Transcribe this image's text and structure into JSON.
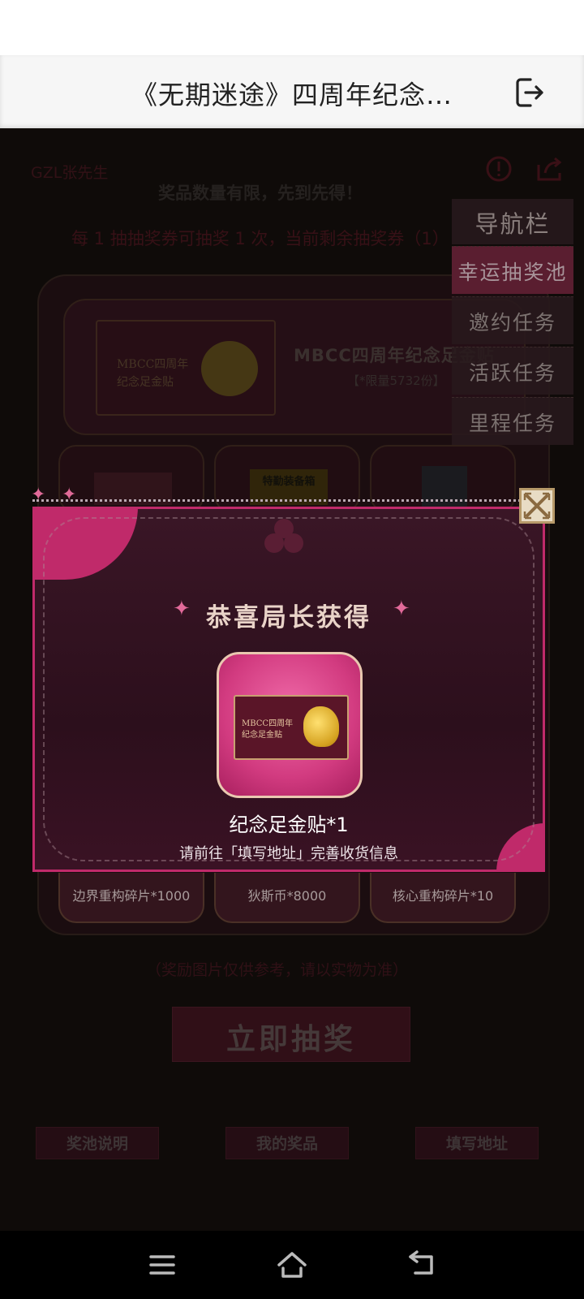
{
  "browser": {
    "title": "《无期迷途》四周年纪念…",
    "exit_icon": "exit-icon"
  },
  "page": {
    "user_name": "GZL张先生",
    "notice": "奖品数量有限，先到先得！",
    "ticket_info": "每 1 抽抽奖券可抽奖 1 次，当前剩余抽奖券（1）",
    "grand_prize": {
      "card_line1": "MBCC四周年",
      "card_line2": "纪念足金贴",
      "name": "MBCC四周年纪念足金贴",
      "limit": "【*限量5732份】"
    },
    "prizes_top_visible": [
      "",
      "特勤装备箱",
      ""
    ],
    "prizes_bottom": [
      "边界重构碎片*1000",
      "狄斯币*8000",
      "核心重构碎片*10"
    ],
    "reference_note": "（奖励图片仅供参考，请以实物为准）",
    "draw_button": "立即抽奖",
    "bottom_buttons": [
      "奖池说明",
      "我的奖品",
      "填写地址"
    ]
  },
  "side_nav": {
    "header": "导航栏",
    "items": [
      {
        "label": "幸运抽奖池",
        "active": true
      },
      {
        "label": "邀约任务",
        "active": false
      },
      {
        "label": "活跃任务",
        "active": false
      },
      {
        "label": "里程任务",
        "active": false
      }
    ]
  },
  "modal": {
    "heading": "恭喜局长获得",
    "plaque_line1": "MBCC四周年",
    "plaque_line2": "纪念足金贴",
    "reward_name": "纪念足金贴*1",
    "reward_hint": "请前往「填写地址」完善收货信息",
    "close_icon": "close-icon"
  },
  "colors": {
    "accent_pink": "#c02a6a",
    "modal_bg": "#2c0f1c",
    "page_bg": "#17120f"
  }
}
